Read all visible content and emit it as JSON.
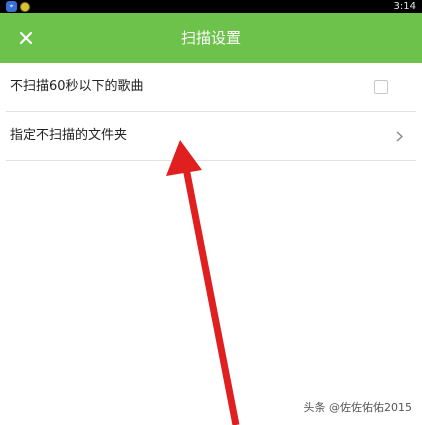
{
  "status_bar": {
    "time": "3:14",
    "icons": [
      "app-icon",
      "emoji-icon"
    ]
  },
  "header": {
    "title": "扫描设置",
    "close_icon": "close-icon",
    "background_color": "#6cc24a"
  },
  "settings": [
    {
      "label": "不扫描60秒以下的歌曲",
      "control": "checkbox",
      "checked": false
    },
    {
      "label": "指定不扫描的文件夹",
      "control": "chevron"
    }
  ],
  "annotation": {
    "arrow_color": "#e02020"
  },
  "watermark": "头条 @佐佐佑佑2015"
}
